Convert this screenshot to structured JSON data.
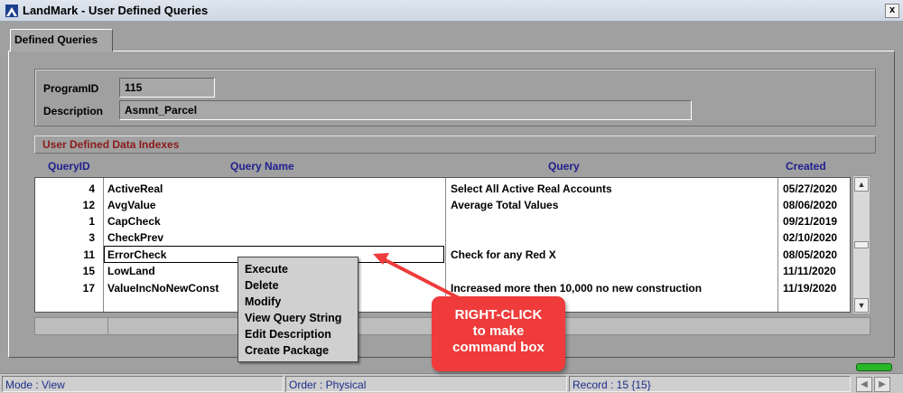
{
  "window": {
    "title": "LandMark - User Defined Queries",
    "close_label": "x"
  },
  "tab": {
    "label": "Defined Queries"
  },
  "info": {
    "program_label": "ProgramID",
    "program_value": "115",
    "description_label": "Description",
    "description_value": "Asmnt_Parcel"
  },
  "section": {
    "title": "User Defined Data Indexes"
  },
  "columns": {
    "id": "QueryID",
    "name": "Query Name",
    "query": "Query",
    "created": "Created"
  },
  "rows": [
    {
      "id": "4",
      "name": "ActiveReal",
      "query": "Select All Active Real Accounts",
      "created": "05/27/2020"
    },
    {
      "id": "12",
      "name": "AvgValue",
      "query": "Average Total Values",
      "created": "08/06/2020"
    },
    {
      "id": "1",
      "name": "CapCheck",
      "query": "",
      "created": "09/21/2019"
    },
    {
      "id": "3",
      "name": "CheckPrev",
      "query": "",
      "created": "02/10/2020"
    },
    {
      "id": "11",
      "name": "ErrorCheck",
      "query": "Check for any Red X",
      "created": "08/05/2020"
    },
    {
      "id": "15",
      "name": "LowLand",
      "query": "",
      "created": "11/11/2020"
    },
    {
      "id": "17",
      "name": "ValueIncNoNewConst",
      "query": "Increased more then 10,000 no new construction",
      "created": "11/19/2020"
    }
  ],
  "context_menu": {
    "items": [
      "Execute",
      "Delete",
      "Modify",
      "View Query String",
      "Edit Description",
      "Create Package"
    ]
  },
  "callout": {
    "line1": "RIGHT-CLICK",
    "line2": "to make",
    "line3": "command box"
  },
  "status": {
    "mode": "Mode : View",
    "order": "Order : Physical",
    "record": "Record : 15 {15}"
  },
  "colors": {
    "callout": "#ef3b3b",
    "section_title": "#8b1a1a",
    "header_text": "#1f1f8f",
    "indicator": "#29b629"
  }
}
